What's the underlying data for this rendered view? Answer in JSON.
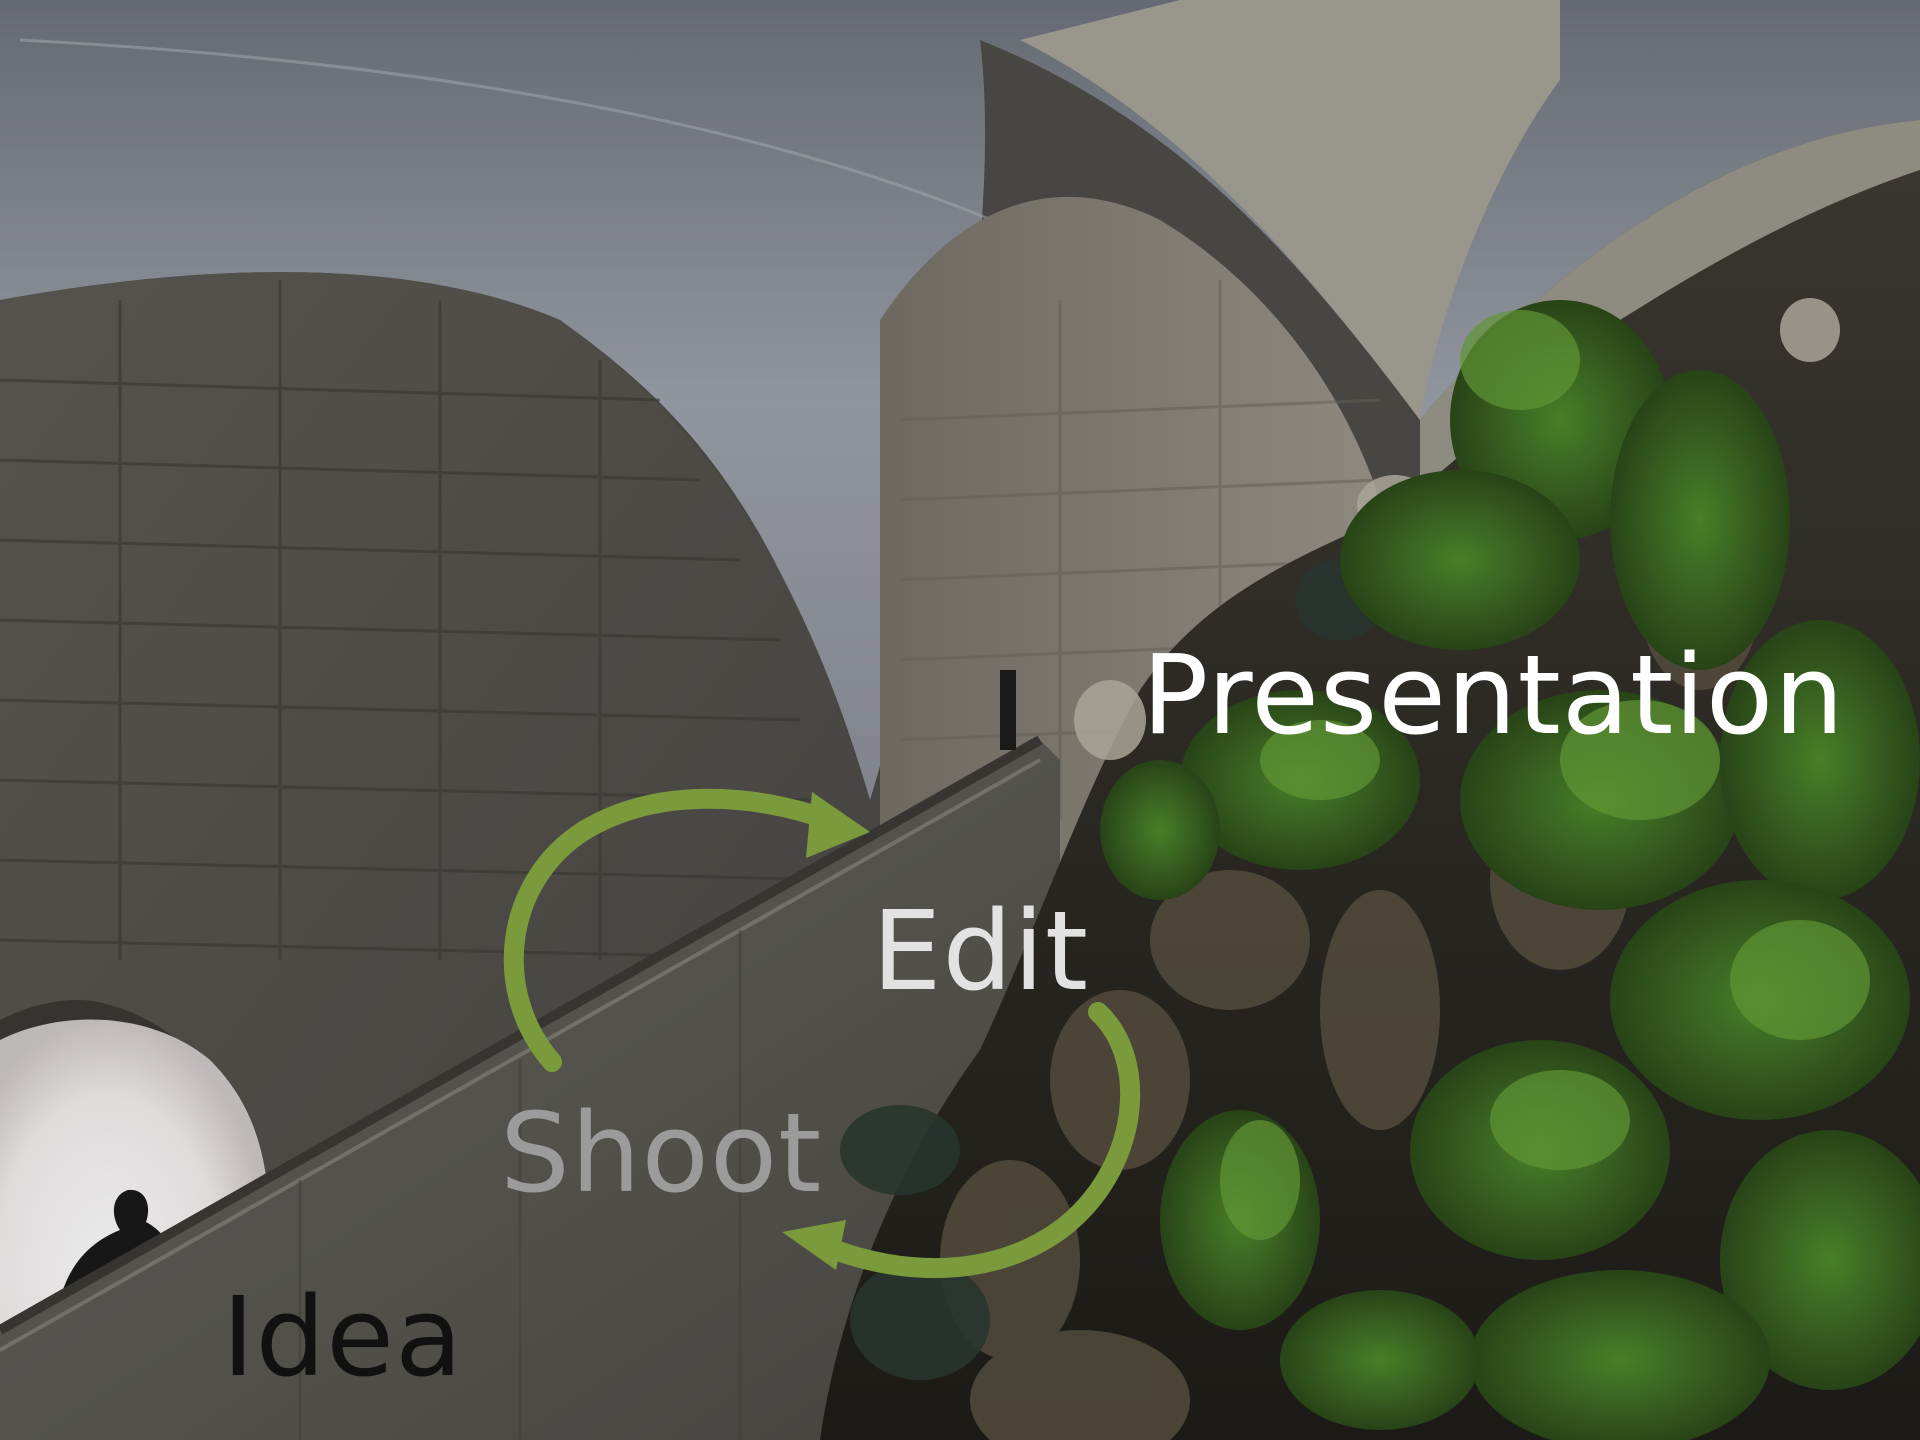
{
  "slide": {
    "words": {
      "presentation": "Presentation",
      "edit": "Edit",
      "shoot": "Shoot",
      "idea": "Idea"
    },
    "arrow_color": "#7a9a3c",
    "arrows": [
      "cycle-arrow-up",
      "cycle-arrow-down"
    ]
  }
}
